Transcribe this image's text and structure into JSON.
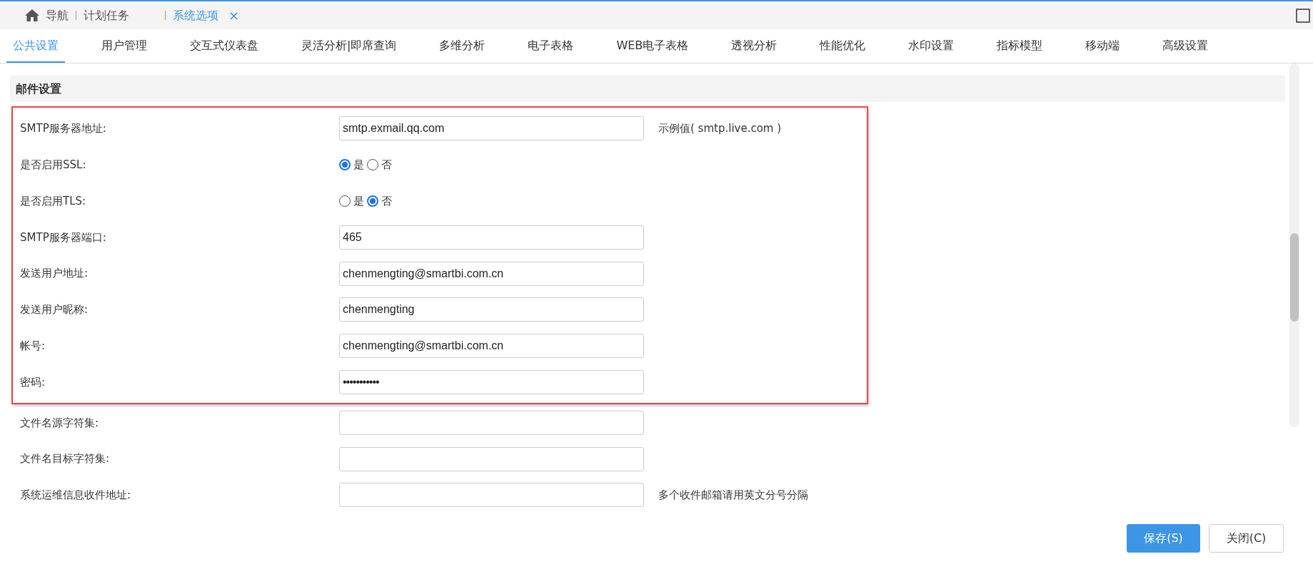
{
  "top_tabs": [
    {
      "label": "导航",
      "kind": "home",
      "selected": false
    },
    {
      "label": "计划任务",
      "kind": "plain",
      "selected": false
    },
    {
      "label": "系统选项",
      "kind": "closable",
      "selected": true,
      "close": "×"
    }
  ],
  "tabs": [
    {
      "label": "公共设置",
      "selected": true
    },
    {
      "label": "用户管理",
      "selected": false
    },
    {
      "label": "交互式仪表盘",
      "selected": false
    },
    {
      "label": "灵活分析|即席查询",
      "selected": false
    },
    {
      "label": "多维分析",
      "selected": false
    },
    {
      "label": "电子表格",
      "selected": false
    },
    {
      "label": "WEB电子表格",
      "selected": false
    },
    {
      "label": "透视分析",
      "selected": false
    },
    {
      "label": "性能优化",
      "selected": false
    },
    {
      "label": "水印设置",
      "selected": false
    },
    {
      "label": "指标模型",
      "selected": false
    },
    {
      "label": "移动端",
      "selected": false
    },
    {
      "label": "高级设置",
      "selected": false
    }
  ],
  "section": {
    "title": "邮件设置"
  },
  "groups": [
    {
      "highlighted": true,
      "rows": [
        {
          "label": "SMTP服务器地址:",
          "kind": "text",
          "value": "smtp.exmail.qq.com",
          "hint": "示例值( smtp.live.com )"
        },
        {
          "label": "是否启用SSL:",
          "kind": "radio",
          "options": [
            {
              "label": "是",
              "selected": true
            },
            {
              "label": "否",
              "selected": false
            }
          ]
        },
        {
          "label": "是否启用TLS:",
          "kind": "radio",
          "options": [
            {
              "label": "是",
              "selected": false
            },
            {
              "label": "否",
              "selected": true
            }
          ]
        },
        {
          "label": "SMTP服务器端口:",
          "kind": "text",
          "value": "465"
        },
        {
          "label": "发送用户地址:",
          "kind": "text",
          "value": "chenmengting@smartbi.com.cn"
        },
        {
          "label": "发送用户昵称:",
          "kind": "text",
          "value": "chenmengting"
        },
        {
          "label": "帐号:",
          "kind": "text",
          "value": "chenmengting@smartbi.com.cn"
        },
        {
          "label": "密码:",
          "kind": "password",
          "value": "•••••••••••"
        }
      ]
    },
    {
      "highlighted": false,
      "rows": [
        {
          "label": "文件名源字符集:",
          "kind": "text",
          "value": ""
        },
        {
          "label": "文件名目标字符集:",
          "kind": "text",
          "value": ""
        },
        {
          "label": "系统运维信息收件地址:",
          "kind": "text",
          "value": "",
          "hint": "多个收件邮箱请用英文分号分隔"
        }
      ]
    }
  ],
  "buttons": [
    {
      "label": "保存(S)",
      "kind": "primary"
    },
    {
      "label": "关闭(C)",
      "kind": "secondary"
    }
  ]
}
